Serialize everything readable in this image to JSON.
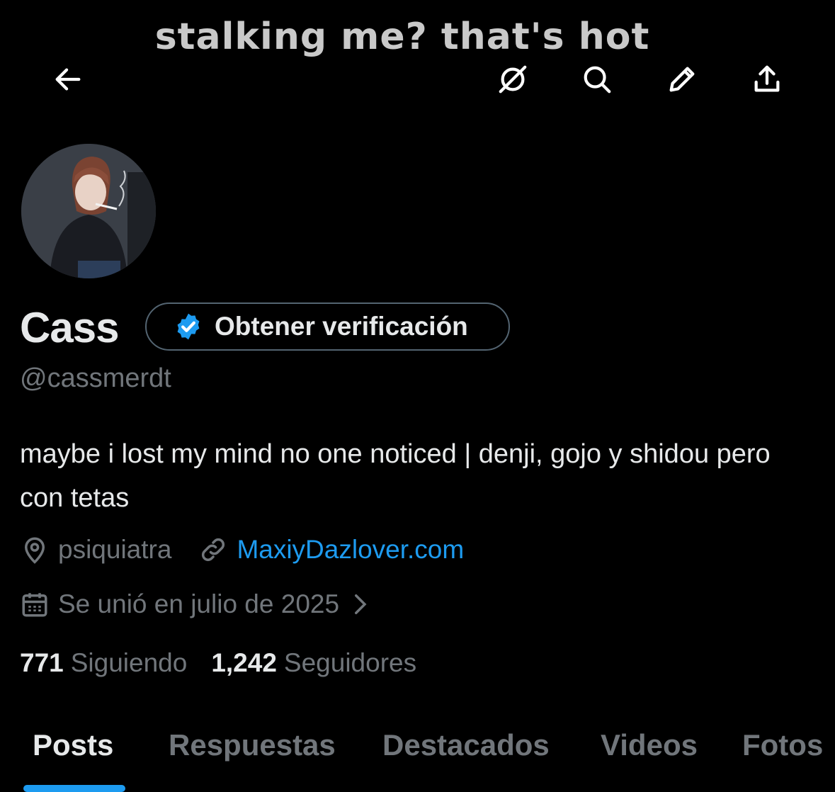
{
  "header": {
    "banner_text": "stalking me? that's hot",
    "back_icon": "arrow-left-icon",
    "icons": [
      "grok-icon",
      "search-icon",
      "edit-icon",
      "share-icon"
    ]
  },
  "profile": {
    "avatar_icon": "profile-avatar",
    "name": "Cass",
    "verify_label": "Obtener verificación",
    "handle": "@cassmerdt",
    "bio": "maybe i lost my mind no one noticed | denji, gojo y shidou pero con tetas",
    "location": "psiquiatra",
    "website": "MaxiyDazlover.com",
    "joined": "Se unió en julio de 2025",
    "following_count": "771",
    "following_label": "Siguiendo",
    "followers_count": "1,242",
    "followers_label": "Seguidores"
  },
  "tabs": [
    "Posts",
    "Respuestas",
    "Destacados",
    "Videos",
    "Fotos"
  ],
  "colors": {
    "accent": "#1d9bf0",
    "muted": "#71767b",
    "text": "#e7e9ea",
    "background": "#000000"
  }
}
